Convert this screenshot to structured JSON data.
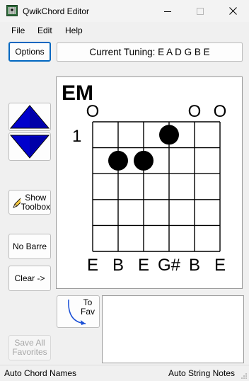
{
  "window": {
    "title": "QwikChord Editor"
  },
  "menu": [
    {
      "label": "File"
    },
    {
      "label": "Edit"
    },
    {
      "label": "Help"
    }
  ],
  "toolbar": {
    "options_label": "Options",
    "tuning_text": "Current Tuning: E A D G B E"
  },
  "sidebar": {
    "show_toolbox_label_1": "Show",
    "show_toolbox_label_2": "Toolbox",
    "no_barre_label": "No Barre",
    "clear_label": "Clear ->",
    "to_fav_label_1": "To",
    "to_fav_label_2": "Fav",
    "save_all_label_1": "Save All",
    "save_all_label_2": "Favorites"
  },
  "chord": {
    "name": "EM",
    "start_fret": "1",
    "open_markers": [
      "O",
      "",
      "",
      "",
      "O",
      "O"
    ],
    "string_notes": [
      "E",
      "B",
      "E",
      "G#",
      "B",
      "E"
    ],
    "fingers": [
      {
        "string": 4,
        "fret": 1
      },
      {
        "string": 2,
        "fret": 2
      },
      {
        "string": 3,
        "fret": 2
      }
    ],
    "num_strings": 6,
    "num_frets": 5
  },
  "status": {
    "left": "Auto Chord Names",
    "right": "Auto String Notes"
  },
  "colors": {
    "arrow_blue": "#0000cc",
    "accent": "#0067c0"
  }
}
